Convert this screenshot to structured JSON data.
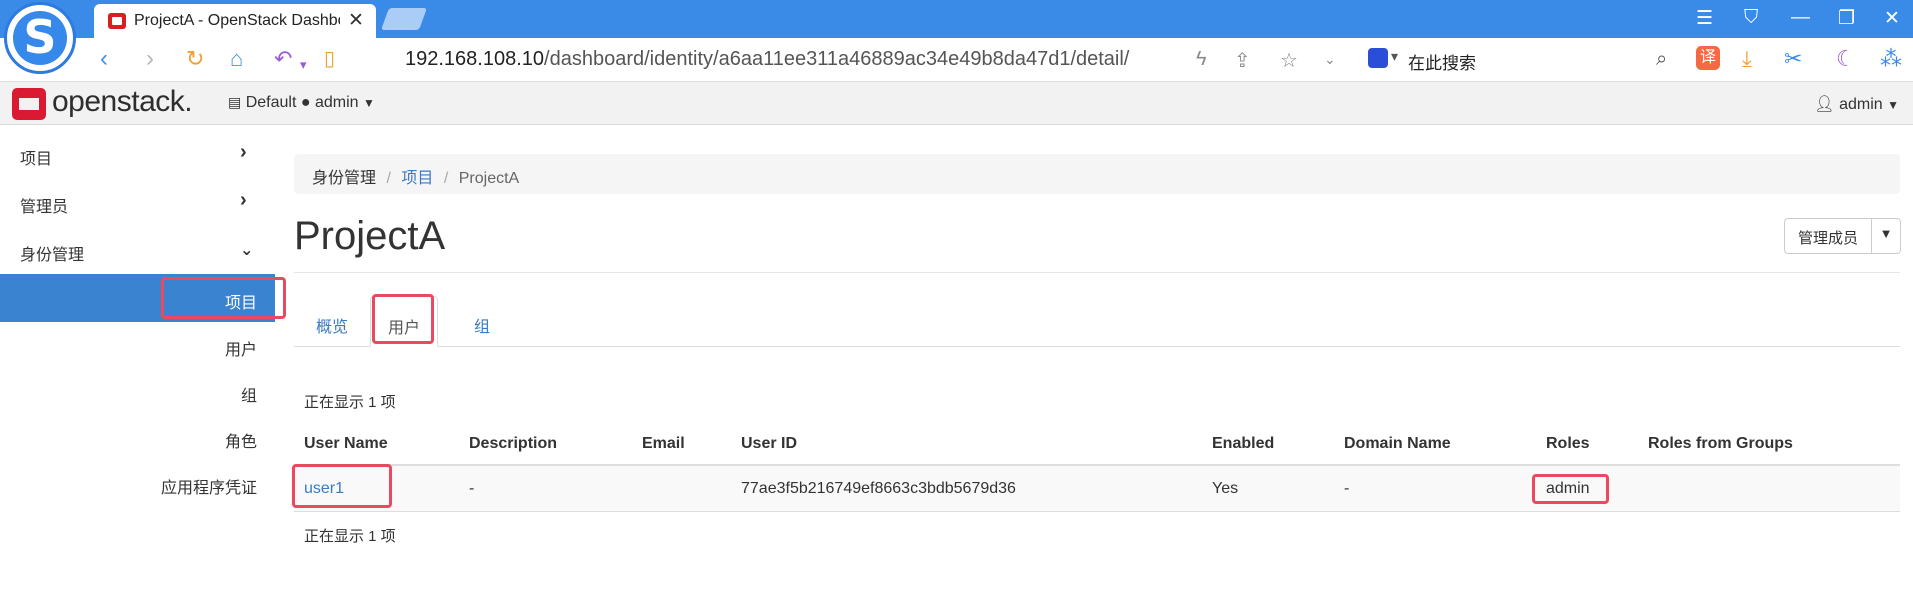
{
  "browser": {
    "tab_title": "ProjectA - OpenStack Dashboard",
    "close_glyph": "✕",
    "url_host": "192.168.108.10",
    "url_path": "/dashboard/identity/a6aa11ee311a46889ac34e49b8da47d1/detail/",
    "search_placeholder": "在此搜索",
    "translate_label": "译"
  },
  "navbar": {
    "brand": "openstack.",
    "domain": "Default",
    "project": "admin",
    "user": "admin"
  },
  "sidebar": {
    "groups": [
      {
        "label": "项目"
      },
      {
        "label": "管理员"
      },
      {
        "label": "身份管理"
      }
    ],
    "identity_items": [
      {
        "label": "项目"
      },
      {
        "label": "用户"
      },
      {
        "label": "组"
      },
      {
        "label": "角色"
      },
      {
        "label": "应用程序凭证"
      }
    ]
  },
  "breadcrumb": {
    "home": "身份管理",
    "section": "项目",
    "current": "ProjectA",
    "sep": "/"
  },
  "page": {
    "title": "ProjectA",
    "manage_members_label": "管理成员"
  },
  "tabs": [
    {
      "label": "概览"
    },
    {
      "label": "用户"
    },
    {
      "label": "组"
    }
  ],
  "table": {
    "count_text": "正在显示 1 项",
    "columns": [
      "User Name",
      "Description",
      "Email",
      "User ID",
      "Enabled",
      "Domain Name",
      "Roles",
      "Roles from Groups"
    ],
    "rows": [
      {
        "user_name": "user1",
        "description": "-",
        "email": "",
        "user_id": "77ae3f5b216749ef8663c3bdb5679d36",
        "enabled": "Yes",
        "domain_name": "-",
        "roles": "admin",
        "roles_from_groups": ""
      }
    ]
  },
  "colors": {
    "chrome_blue": "#3a8ae8",
    "sidebar_active": "#3a83d1",
    "link": "#3a79c4",
    "highlight_red": "#ea4a60",
    "openstack_red": "#da1a32"
  }
}
